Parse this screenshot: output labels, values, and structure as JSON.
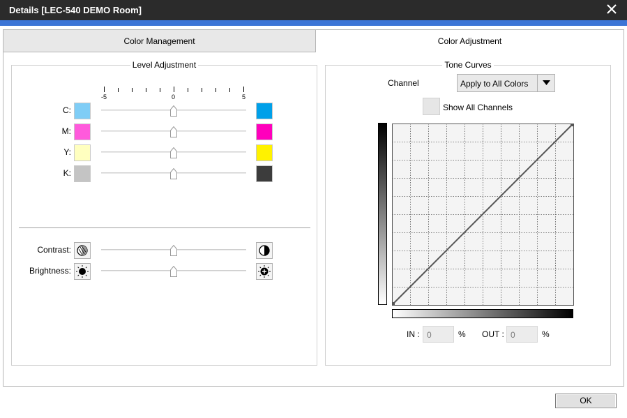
{
  "window": {
    "title": "Details [LEC-540 DEMO Room]"
  },
  "tabs": [
    {
      "label": "Color Management",
      "selected": false
    },
    {
      "label": "Color Adjustment",
      "selected": true
    }
  ],
  "level_adjustment": {
    "title": "Level Adjustment",
    "scale_labels": [
      "-5",
      "0",
      "5"
    ],
    "channels": [
      {
        "label": "C:",
        "value": 0,
        "low_color": "#7fcdf6",
        "high_color": "#00a0e9"
      },
      {
        "label": "M:",
        "value": 0,
        "low_color": "#ff5adc",
        "high_color": "#ff00bc"
      },
      {
        "label": "Y:",
        "value": 0,
        "low_color": "#ffffbf",
        "high_color": "#fff200"
      },
      {
        "label": "K:",
        "value": 0,
        "low_color": "#c4c4c4",
        "high_color": "#3c3c3c"
      }
    ],
    "contrast": {
      "label": "Contrast:",
      "value": 0
    },
    "brightness": {
      "label": "Brightness:",
      "value": 0
    }
  },
  "tone_curves": {
    "title": "Tone Curves",
    "channel_label": "Channel",
    "channel_value": "Apply to All Colors",
    "show_all_label": "Show All Channels",
    "show_all_checked": false,
    "in_label": "IN :",
    "in_value": "0",
    "out_label": "OUT :",
    "out_value": "0",
    "percent": "%",
    "curve_points": [
      [
        0,
        0
      ],
      [
        100,
        100
      ]
    ]
  },
  "footer": {
    "ok_label": "OK"
  }
}
